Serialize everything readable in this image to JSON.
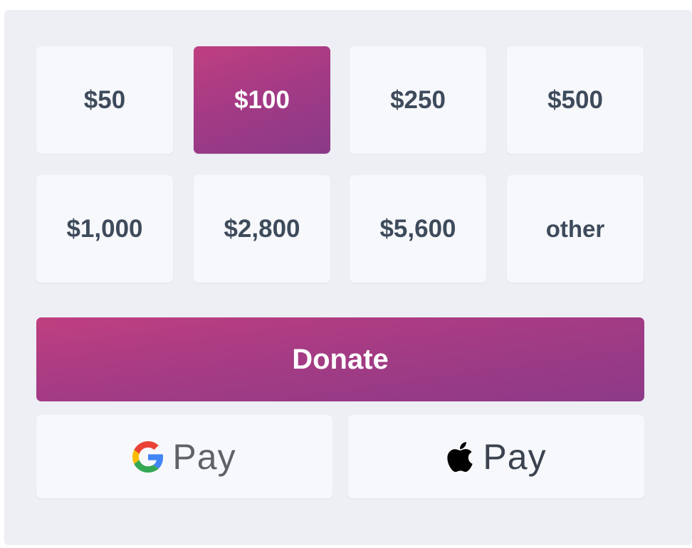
{
  "amounts": [
    {
      "label": "$50"
    },
    {
      "label": "$100",
      "selected": true
    },
    {
      "label": "$250"
    },
    {
      "label": "$500"
    },
    {
      "label": "$1,000"
    },
    {
      "label": "$2,800"
    },
    {
      "label": "$5,600"
    },
    {
      "label": "other"
    }
  ],
  "donate": {
    "label": "Donate"
  },
  "payments": {
    "google_pay": {
      "label": "Pay",
      "icon": "google-g-icon"
    },
    "apple_pay": {
      "label": "Pay",
      "icon": "apple-logo-icon"
    }
  },
  "colors": {
    "accent_start": "#bf3f80",
    "accent_end": "#8a3a88",
    "panel_background": "#eeeff4",
    "card_background": "#f7f8fb",
    "text": "#3e4b5c"
  }
}
